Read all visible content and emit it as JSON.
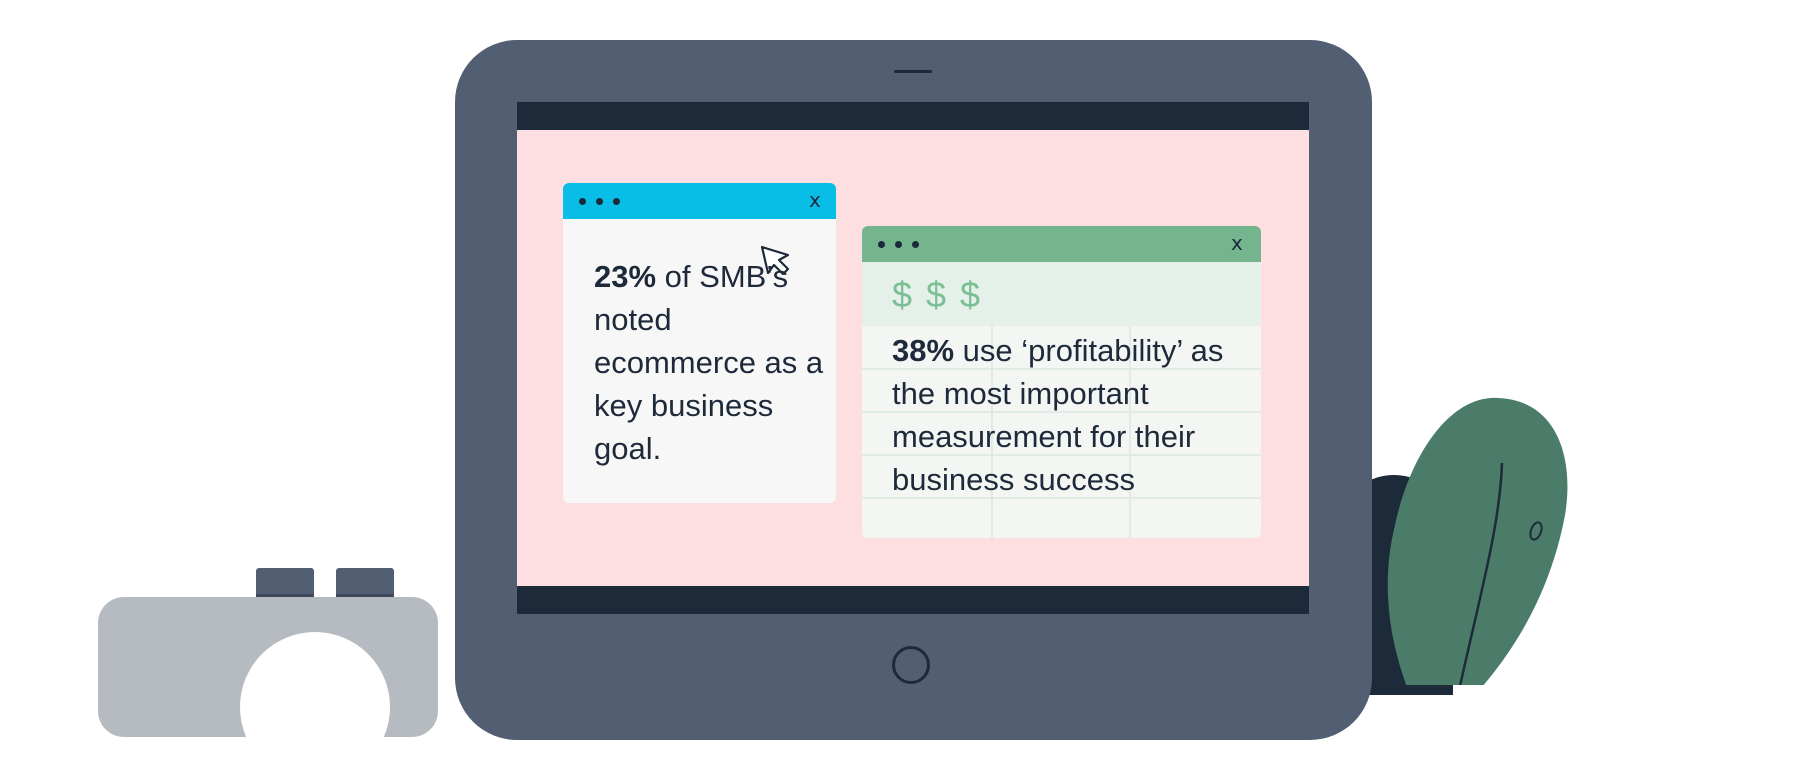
{
  "card_left": {
    "stat": "23%",
    "text": "of SMB’s noted ecommerce as a key business goal.",
    "close": "x"
  },
  "card_right": {
    "symbols": "$ $ $",
    "stat": "38%",
    "text": "use ‘profitability’ as the most important measurement for their business success",
    "close": "x"
  },
  "colors": {
    "tablet": "#525e72",
    "screen": "#fddfe1",
    "card_left_header": "#08bde6",
    "card_right_header": "#75b58d",
    "leaf": "#4b7c69"
  }
}
